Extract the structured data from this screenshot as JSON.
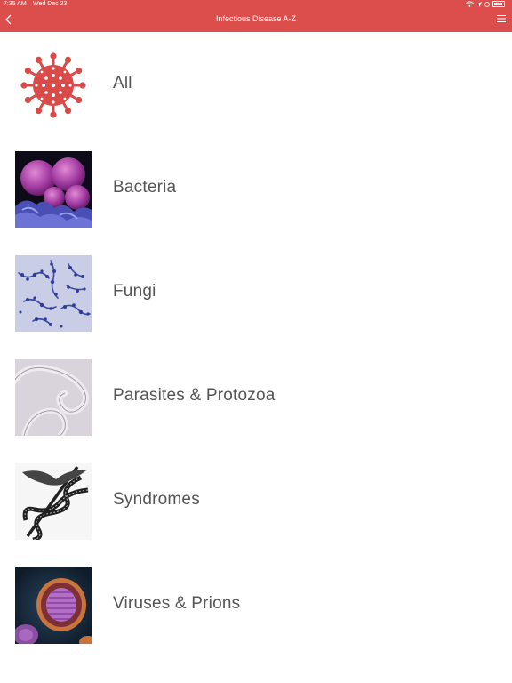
{
  "status_bar": {
    "time": "7:35 AM",
    "date": "Wed Dec 23"
  },
  "nav": {
    "title": "Infectious Disease A-Z",
    "back_icon": "chevron-left-icon",
    "menu_icon": "hamburger-menu-icon"
  },
  "colors": {
    "header": "#dc4e4c",
    "text": "#555555"
  },
  "categories": [
    {
      "label": "All",
      "icon": "virus-icon"
    },
    {
      "label": "Bacteria",
      "icon": "bacteria-image"
    },
    {
      "label": "Fungi",
      "icon": "fungi-image"
    },
    {
      "label": "Parasites & Protozoa",
      "icon": "parasites-image"
    },
    {
      "label": "Syndromes",
      "icon": "caduceus-image"
    },
    {
      "label": "Viruses & Prions",
      "icon": "virus-image"
    }
  ]
}
